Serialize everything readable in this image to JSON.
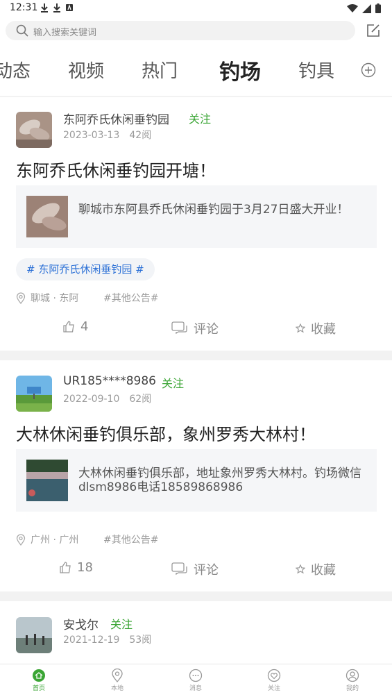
{
  "status_bar": {
    "time": "12:31"
  },
  "search": {
    "placeholder": "输入搜索关键词"
  },
  "tabs": [
    {
      "label": "动态",
      "active": false
    },
    {
      "label": "视频",
      "active": false
    },
    {
      "label": "热门",
      "active": false
    },
    {
      "label": "钓场",
      "active": true
    },
    {
      "label": "钓具",
      "active": false
    }
  ],
  "posts": [
    {
      "user": "东阿乔氏休闲垂钓园",
      "follow": "关注",
      "date": "2023-03-13",
      "views": "42阅",
      "title": "东阿乔氏休闲垂钓园开塘！",
      "quote": "聊城市东阿县乔氏休闲垂钓园于3月27日盛大开业！",
      "topic": "# 东阿乔氏休闲垂钓园 #",
      "location": "聊城 · 东阿",
      "tag": "#其他公告#",
      "likes": "4",
      "comment": "评论",
      "collect": "收藏"
    },
    {
      "user": "UR185****8986",
      "follow": "关注",
      "date": "2022-09-10",
      "views": "62阅",
      "title": "大林休闲垂钓俱乐部，象州罗秀大林村！",
      "quote": "大林休闲垂钓俱乐部，地址象州罗秀大林村。钓场微信dlsm8986电话18589868986",
      "location": "广州 · 广州",
      "tag": "#其他公告#",
      "likes": "18",
      "comment": "评论",
      "collect": "收藏"
    },
    {
      "user": "安戈尔",
      "follow": "关注",
      "date": "2021-12-19",
      "views": "53阅"
    }
  ],
  "bottom_nav": [
    {
      "label": "首页",
      "icon": "home-icon",
      "active": true
    },
    {
      "label": "本地",
      "icon": "location-icon",
      "active": false
    },
    {
      "label": "消息",
      "icon": "message-icon",
      "active": false
    },
    {
      "label": "关注",
      "icon": "follow-icon",
      "active": false
    },
    {
      "label": "我的",
      "icon": "profile-icon",
      "active": false
    }
  ],
  "colors": {
    "accent": "#3aa534",
    "topic": "#2a6fd6"
  }
}
